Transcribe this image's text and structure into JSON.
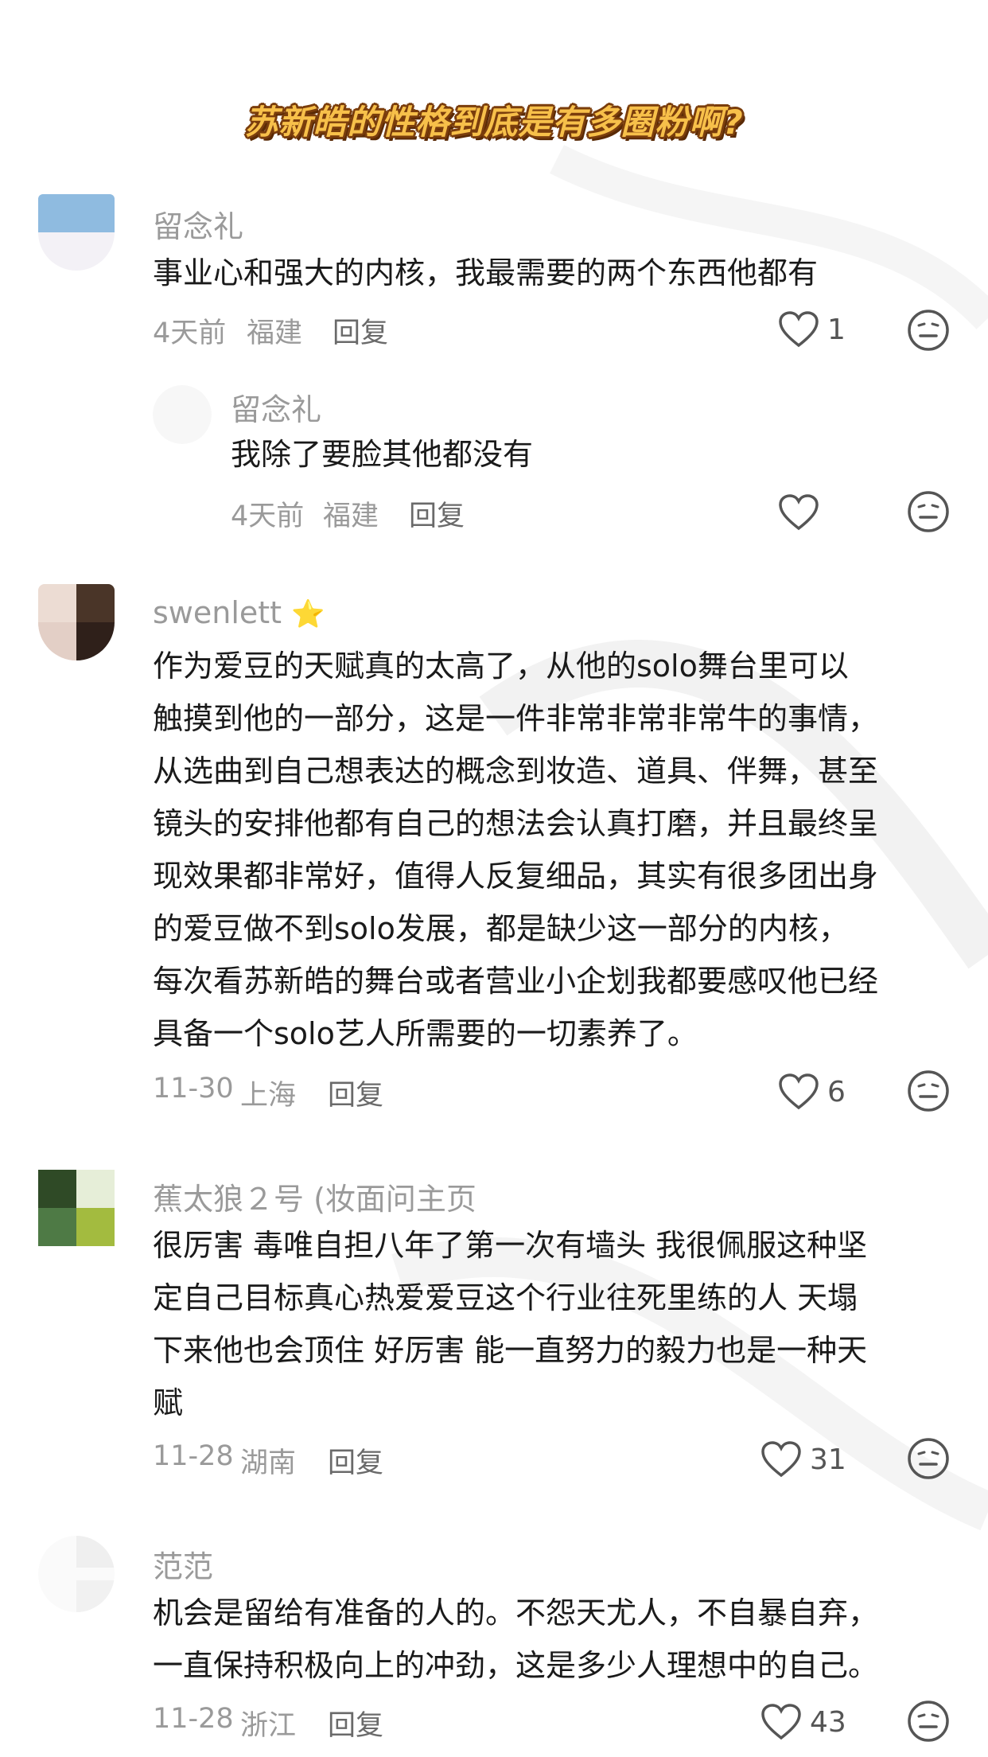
{
  "header": {
    "title": "苏新皓的性格到底是有多圈粉啊?"
  },
  "colors": {
    "meta_gray": "#9a9a9a",
    "text": "#1a1a1a",
    "title_fill": "#f7c04a",
    "title_stroke": "#7a3d0c"
  },
  "comments": [
    {
      "username": "留念礼",
      "text": "事业心和强大的内核，我最需要的两个东西他都有",
      "date": "4天前",
      "location": "福建",
      "reply_label": "回复",
      "likes": "1",
      "reply": {
        "username": "留念礼",
        "text": "我除了要脸其他都没有",
        "date": "4天前",
        "location": "福建",
        "reply_label": "回复",
        "likes": ""
      }
    },
    {
      "username": "swenlett",
      "badge": "⭐",
      "lines": [
        "作为爱豆的天赋真的太高了，从他的solo舞台里可以",
        "触摸到他的一部分，这是一件非常非常非常牛的事情，",
        "从选曲到自己想表达的概念到妆造、道具、伴舞，甚至",
        "镜头的安排他都有自己的想法会认真打磨，并且最终呈",
        "现效果都非常好，值得人反复细品，其实有很多团出身",
        "的爱豆做不到solo发展，都是缺少这一部分的内核，",
        "每次看苏新皓的舞台或者营业小企划我都要感叹他已经",
        "具备一个solo艺人所需要的一切素养了。"
      ],
      "date": "11-30",
      "location": "上海",
      "reply_label": "回复",
      "likes": "6"
    },
    {
      "username": "蕉太狼２号 (妆面问主页",
      "lines": [
        "很厉害 毒唯自担八年了第一次有墙头 我很佩服这种坚",
        "定自己目标真心热爱爱豆这个行业往死里练的人 天塌",
        "下来他也会顶住 好厉害 能一直努力的毅力也是一种天",
        "赋"
      ],
      "date": "11-28",
      "location": "湖南",
      "reply_label": "回复",
      "likes": "31"
    },
    {
      "username": "范范",
      "lines": [
        "机会是留给有准备的人的。不怨天尤人，不自暴自弃，",
        "一直保持积极向上的冲劲，这是多少人理想中的自己。"
      ],
      "date": "11-28",
      "location": "浙江",
      "reply_label": "回复",
      "likes": "43"
    }
  ],
  "icons": {
    "like": "heart-outline-icon",
    "emoji": "neutral-face-icon"
  }
}
